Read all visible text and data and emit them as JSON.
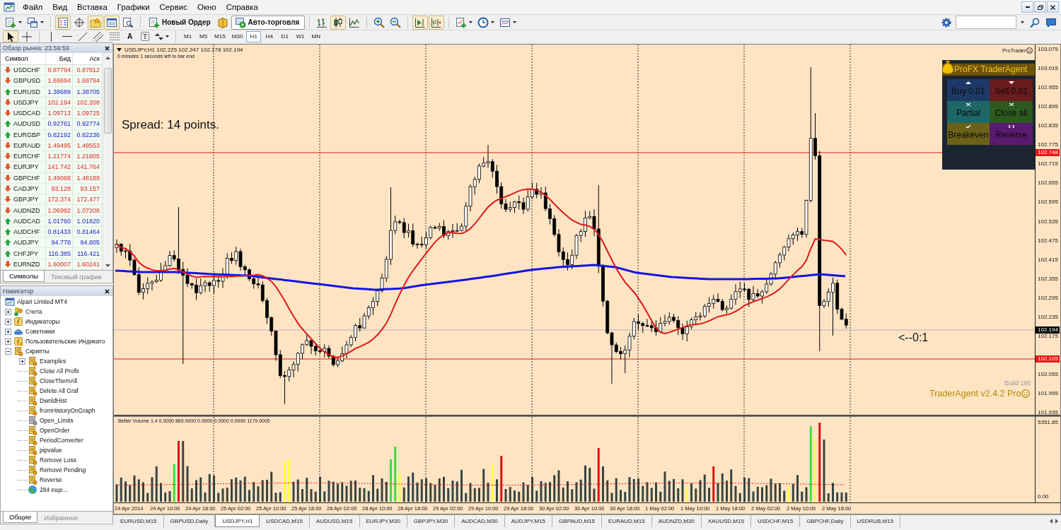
{
  "menu_bar": {
    "items": [
      "Файл",
      "Вид",
      "Вставка",
      "Графики",
      "Сервис",
      "Окно",
      "Справка"
    ]
  },
  "toolbar": {
    "buttons": [
      {
        "kind": "new-chart",
        "on": false
      },
      {
        "kind": "profiles",
        "on": false
      },
      {
        "kind": "market-watch",
        "on": true
      },
      {
        "kind": "data-window",
        "on": false
      },
      {
        "kind": "navigator",
        "on": true
      },
      {
        "kind": "terminal",
        "on": true
      },
      {
        "kind": "tester",
        "on": false
      },
      {
        "kind": "new-order",
        "on": false,
        "label": "Новый Ордер"
      },
      {
        "kind": "editor",
        "on": false
      },
      {
        "kind": "autotrading",
        "on": true,
        "label": "Авто-торговля"
      },
      {
        "kind": "bar-chart",
        "on": false
      },
      {
        "kind": "candles",
        "on": true
      },
      {
        "kind": "line-chart",
        "on": false
      },
      {
        "kind": "zoom-in",
        "on": false
      },
      {
        "kind": "zoom-out",
        "on": false
      },
      {
        "kind": "autoscroll",
        "on": true
      },
      {
        "kind": "chart-shift",
        "on": true
      },
      {
        "kind": "indicators",
        "on": false
      },
      {
        "kind": "periods",
        "on": false
      },
      {
        "kind": "templates",
        "on": false
      }
    ]
  },
  "draw_toolbar": {
    "tools": [
      {
        "kind": "cursor",
        "on": true
      },
      {
        "kind": "crosshair",
        "on": false
      },
      {
        "kind": "vline",
        "on": false
      },
      {
        "kind": "hline",
        "on": false
      },
      {
        "kind": "trendline",
        "on": false
      },
      {
        "kind": "channel",
        "on": false
      },
      {
        "kind": "fibo",
        "on": false
      },
      {
        "kind": "text",
        "on": false,
        "glyph": "A"
      },
      {
        "kind": "label",
        "on": false,
        "glyph": "T"
      },
      {
        "kind": "arrows",
        "on": false
      }
    ],
    "timeframes": [
      {
        "label": "M1",
        "selected": false
      },
      {
        "label": "M5",
        "selected": false
      },
      {
        "label": "M15",
        "selected": false
      },
      {
        "label": "M30",
        "selected": false
      },
      {
        "label": "H1",
        "selected": true
      },
      {
        "label": "H4",
        "selected": false
      },
      {
        "label": "D1",
        "selected": false
      },
      {
        "label": "W1",
        "selected": false
      },
      {
        "label": "MN",
        "selected": false
      }
    ]
  },
  "market_watch": {
    "title": "Обзор рынка: 23:59:59",
    "columns": [
      "Символ",
      "Бид",
      "Аск"
    ],
    "rows": [
      {
        "symbol": "USDCHF",
        "bid": "0.87794",
        "ask": "0.87812",
        "rising": false
      },
      {
        "symbol": "GBPUSD",
        "bid": "1.68694",
        "ask": "1.68794",
        "rising": false
      },
      {
        "symbol": "EURUSD",
        "bid": "1.38689",
        "ask": "1.38705",
        "rising": true
      },
      {
        "symbol": "USDJPY",
        "bid": "102.194",
        "ask": "102.208",
        "rising": false
      },
      {
        "symbol": "USDCAD",
        "bid": "1.09713",
        "ask": "1.09725",
        "rising": false
      },
      {
        "symbol": "AUDUSD",
        "bid": "0.92761",
        "ask": "0.92774",
        "rising": true
      },
      {
        "symbol": "EURGBP",
        "bid": "0.82192",
        "ask": "0.82236",
        "rising": true
      },
      {
        "symbol": "EURAUD",
        "bid": "1.49495",
        "ask": "1.49553",
        "rising": false
      },
      {
        "symbol": "EURCHF",
        "bid": "1.21774",
        "ask": "1.21805",
        "rising": false
      },
      {
        "symbol": "EURJPY",
        "bid": "141.742",
        "ask": "141.764",
        "rising": false
      },
      {
        "symbol": "GBPCHF",
        "bid": "1.48068",
        "ask": "1.48189",
        "rising": false
      },
      {
        "symbol": "CADJPY",
        "bid": "93.128",
        "ask": "93.157",
        "rising": false
      },
      {
        "symbol": "GBPJPY",
        "bid": "172.374",
        "ask": "172.477",
        "rising": false
      },
      {
        "symbol": "AUDNZD",
        "bid": "1.06992",
        "ask": "1.07208",
        "rising": false
      },
      {
        "symbol": "AUDCAD",
        "bid": "1.01760",
        "ask": "1.01820",
        "rising": true
      },
      {
        "symbol": "AUDCHF",
        "bid": "0.81433",
        "ask": "0.81464",
        "rising": true
      },
      {
        "symbol": "AUDJPY",
        "bid": "94.778",
        "ask": "94.805",
        "rising": true
      },
      {
        "symbol": "CHFJPY",
        "bid": "116.385",
        "ask": "116.421",
        "rising": true
      },
      {
        "symbol": "EURNZD",
        "bid": "1.60007",
        "ask": "1.60241",
        "rising": false
      }
    ],
    "tabs": [
      {
        "label": "Символы",
        "selected": true
      },
      {
        "label": "Тиковый график",
        "selected": false
      }
    ]
  },
  "navigator": {
    "title": "Навигатор",
    "tree": [
      {
        "label": "Alpari Limited MT4",
        "kind": "terminal",
        "children": [
          {
            "label": "Счета",
            "kind": "accounts",
            "expanded": false
          },
          {
            "label": "Индикаторы",
            "kind": "indicators",
            "expanded": false
          },
          {
            "label": "Советники",
            "kind": "experts",
            "expanded": false
          },
          {
            "label": "Пользовательские Индикато",
            "kind": "custom",
            "expanded": false
          },
          {
            "label": "Скрипты",
            "kind": "scripts",
            "expanded": true,
            "children": [
              {
                "label": "Examples",
                "kind": "script",
                "expanded": false
              },
              {
                "label": "Close All Profit",
                "kind": "script"
              },
              {
                "label": "CloseThemAll",
                "kind": "script"
              },
              {
                "label": "Delete All Graf",
                "kind": "script"
              },
              {
                "label": "DwnldHist",
                "kind": "script"
              },
              {
                "label": "fromHistoryOnGraph",
                "kind": "script"
              },
              {
                "label": "Open_Limits",
                "kind": "inactive"
              },
              {
                "label": "OpenOrder",
                "kind": "script"
              },
              {
                "label": "PeriodConverter",
                "kind": "script"
              },
              {
                "label": "pipvalue",
                "kind": "script"
              },
              {
                "label": "Remove Loss",
                "kind": "script"
              },
              {
                "label": "Remove Pending",
                "kind": "script"
              },
              {
                "label": "Reverse",
                "kind": "script"
              },
              {
                "label": "284 еще...",
                "kind": "more"
              }
            ]
          }
        ]
      }
    ],
    "tabs": [
      {
        "label": "Общие",
        "selected": true
      },
      {
        "label": "Избранное",
        "selected": false
      }
    ]
  },
  "chart": {
    "header": "USDJPY,H1  102.225 102.247 102.178 102.194",
    "countdown": "0 minutes 1 seconds left to bar end",
    "spread": "Spread: 14 points.",
    "marker": "<--0:1",
    "brand": "ProTrader",
    "build": "Build 195",
    "version": "TraderAgent v2.4.2 Pro",
    "price_axis": [
      "103.075",
      "103.015",
      "102.955",
      "102.895",
      "102.835",
      "102.775",
      "102.715",
      "102.655",
      "102.595",
      "102.535",
      "102.475",
      "102.415",
      "102.355",
      "102.295",
      "102.235",
      "102.175",
      "102.055",
      "101.995",
      "101.935"
    ],
    "price_tags": [
      {
        "label": "102.748",
        "kind": "level"
      },
      {
        "label": "102.194",
        "kind": "bid"
      },
      {
        "label": "102.105",
        "kind": "level"
      }
    ],
    "trade_panel": {
      "title": "ProFX TraderAgent",
      "buttons": [
        {
          "label": "Buy 0.01",
          "kind": "buy",
          "color": "#1d3968"
        },
        {
          "label": "Sell 0.01",
          "kind": "sell",
          "color": "#6a1b1d"
        },
        {
          "label": "Partial",
          "kind": "partial",
          "color": "#1d6866"
        },
        {
          "label": "Close all",
          "kind": "close-all",
          "color": "#2c5a1e"
        },
        {
          "label": "Breakeven",
          "kind": "breakeven",
          "color": "#6a6219"
        },
        {
          "label": "Reverse",
          "kind": "reverse",
          "color": "#5a1a70"
        }
      ]
    },
    "volume": {
      "header": "Better Volume 1.4 0.0000 869.0000 0.0000 0.0000 0.0000 1179.0000",
      "axis": [
        "5351.85",
        "0.00"
      ]
    },
    "time_axis": [
      "24 Apr 2014",
      "24 Apr 10:00",
      "24 Apr 18:00",
      "25 Apr 02:00",
      "25 Apr 10:00",
      "25 Apr 18:00",
      "28 Apr 02:00",
      "28 Apr 10:00",
      "28 Apr 18:00",
      "29 Apr 02:00",
      "29 Apr 10:00",
      "29 Apr 18:00",
      "30 Apr 02:00",
      "30 Apr 10:00",
      "30 Apr 18:00",
      "1 May 02:00",
      "1 May 10:00",
      "1 May 18:00",
      "2 May 02:00",
      "2 May 10:00",
      "2 May 18:00"
    ]
  },
  "chart_tabs": [
    {
      "label": "EURUSD,M15",
      "selected": false
    },
    {
      "label": "GBPUSD,Daily",
      "selected": false
    },
    {
      "label": "USDJPY,H1",
      "selected": true
    },
    {
      "label": "USDCAD,M15",
      "selected": false
    },
    {
      "label": "AUDUSD,M15",
      "selected": false
    },
    {
      "label": "EURJPY,M30",
      "selected": false
    },
    {
      "label": "GBPJPY,M30",
      "selected": false
    },
    {
      "label": "AUDCAD,M30",
      "selected": false
    },
    {
      "label": "AUDJPY,M15",
      "selected": false
    },
    {
      "label": "GBPAUD,M15",
      "selected": false
    },
    {
      "label": "EURAUD,M15",
      "selected": false
    },
    {
      "label": "AUDNZD,M30",
      "selected": false
    },
    {
      "label": "XAUUSD,M15",
      "selected": false
    },
    {
      "label": "USDCHF,M15",
      "selected": false
    },
    {
      "label": "GBPCHF,Daily",
      "selected": false
    },
    {
      "label": "USDRUB,M15",
      "selected": false
    }
  ]
}
